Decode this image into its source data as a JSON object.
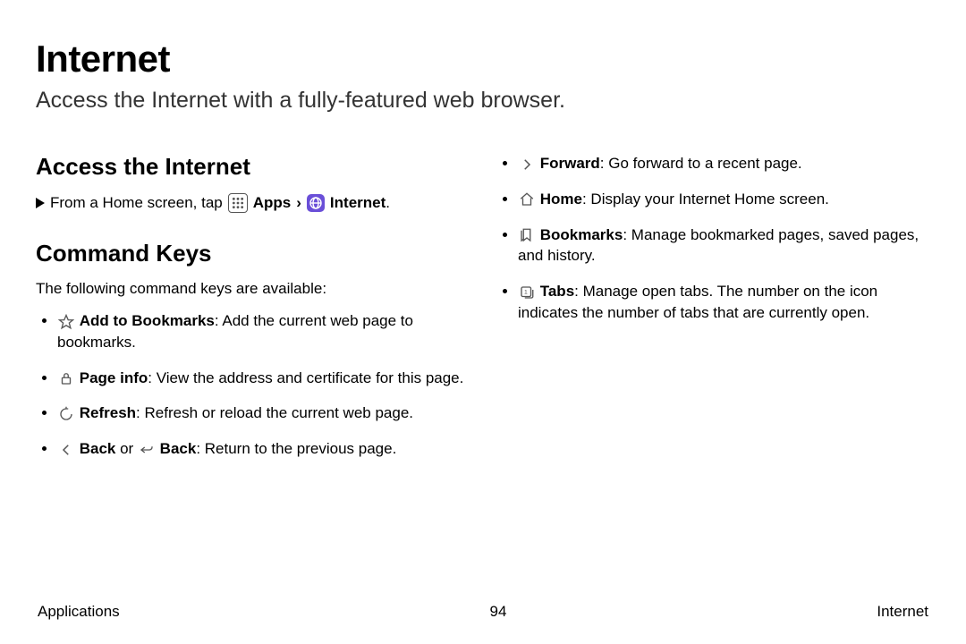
{
  "title": "Internet",
  "subtitle": "Access the Internet with a fully-featured web browser.",
  "access": {
    "heading": "Access the Internet",
    "step_prefix": "From a Home screen, tap",
    "apps_label": "Apps",
    "chevron": "›",
    "internet_label": "Internet",
    "period": "."
  },
  "command": {
    "heading": "Command Keys",
    "intro": "The following command keys are available:"
  },
  "col1_items": [
    {
      "icon": "star",
      "label": "Add to Bookmarks",
      "colon": ": ",
      "desc": "Add the current web page to bookmarks."
    },
    {
      "icon": "lock",
      "label": "Page info",
      "colon": ": ",
      "desc": "View the address and certificate for this page."
    },
    {
      "icon": "refresh",
      "label": "Refresh",
      "colon": ": ",
      "desc": "Refresh or reload the current web page."
    },
    {
      "icon": "back",
      "label": "Back",
      "colon": "",
      "mid": " or ",
      "icon2": "back-alt",
      "label2": "Back",
      "colon2": ": ",
      "desc": "Return to the previous page."
    }
  ],
  "col2_items": [
    {
      "icon": "forward",
      "label": "Forward",
      "colon": ": ",
      "desc": "Go forward to a recent page."
    },
    {
      "icon": "home",
      "label": "Home",
      "colon": ": ",
      "desc": "Display your Internet Home screen."
    },
    {
      "icon": "bookmark",
      "label": "Bookmarks",
      "colon": ": ",
      "desc": "Manage bookmarked pages, saved pages, and history."
    },
    {
      "icon": "tabs",
      "label": "Tabs",
      "colon": ": ",
      "desc": "Manage open tabs. The number on the icon indicates the number of tabs that are currently open."
    }
  ],
  "footer": {
    "left": "Applications",
    "center": "94",
    "right": "Internet"
  }
}
